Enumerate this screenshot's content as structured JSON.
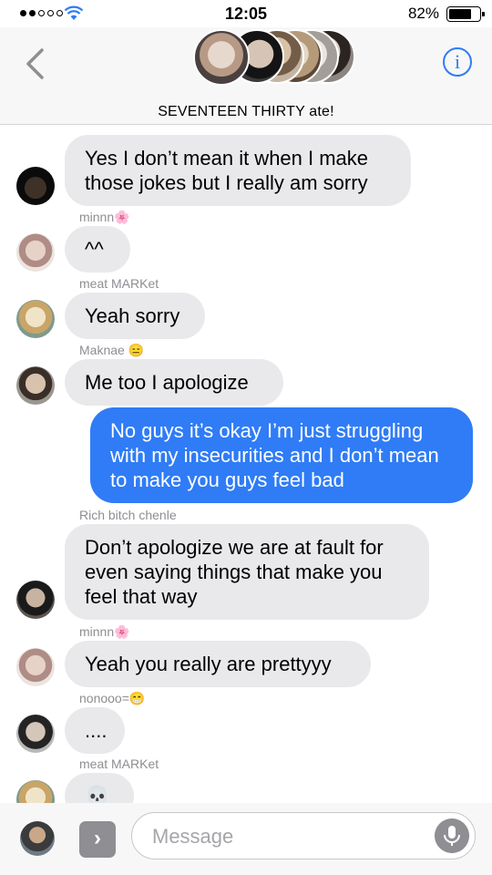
{
  "status_bar": {
    "time": "12:05",
    "battery_percent": "82%",
    "battery_level": 0.82,
    "signal_bars_filled": 2,
    "signal_bars_total": 5
  },
  "header": {
    "title": "SEVENTEEN THIRTY ate!",
    "back_icon": "chevron-left-icon",
    "info_icon": "info-icon",
    "info_glyph": "i"
  },
  "messages": [
    {
      "sender": "",
      "text": "Yes I don’t mean it when I make those jokes but I really am sorry",
      "outgoing": false
    },
    {
      "sender": "minnn🌸",
      "text": "^^",
      "outgoing": false
    },
    {
      "sender": "meat MARKet",
      "text": "Yeah sorry",
      "outgoing": false
    },
    {
      "sender": "Maknae 😑",
      "text": "Me too I apologize",
      "outgoing": false
    },
    {
      "sender": "",
      "text": "No guys it’s okay I’m just struggling with my insecurities and I don’t mean to make you guys feel bad",
      "outgoing": true
    },
    {
      "sender": "Rich bitch chenle",
      "text": "Don’t apologize we are at fault for even saying things that make you feel that way",
      "outgoing": false
    },
    {
      "sender": "minnn🌸",
      "text": "Yeah you really are prettyyy",
      "outgoing": false
    },
    {
      "sender": "nonooo=😁",
      "text": "....",
      "outgoing": false
    },
    {
      "sender": "meat MARKet",
      "text": "💀",
      "outgoing": false
    }
  ],
  "composer": {
    "placeholder": "Message",
    "expand_glyph": "›",
    "mic_icon": "microphone-icon"
  },
  "colors": {
    "outgoing_bubble": "#2f7cf6",
    "incoming_bubble": "#e9e9eb",
    "accent": "#2f7cf6",
    "sender_label": "#8e8e93"
  }
}
